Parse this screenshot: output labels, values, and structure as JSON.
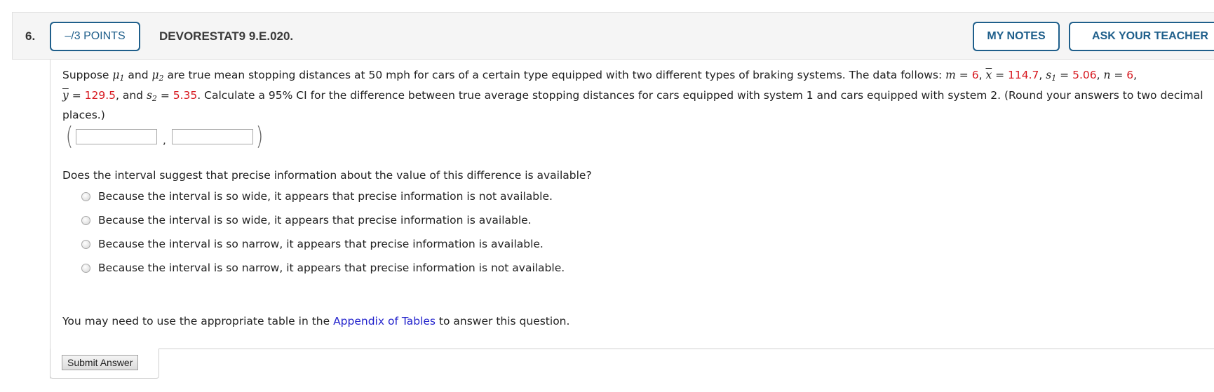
{
  "header": {
    "question_number": "6.",
    "points_label": "–/3 POINTS",
    "question_id": "DEVORESTAT9 9.E.020.",
    "my_notes_label": "MY NOTES",
    "ask_teacher_label": "ASK YOUR TEACHER",
    "accent_color": "#1f5f8b"
  },
  "prompt": {
    "intro_1": "Suppose ",
    "mu": "μ",
    "sub1": "1",
    "and": " and ",
    "sub2": "2",
    "intro_2": " are true mean stopping distances at 50 mph for cars of a certain type equipped with two different types of braking systems. The data follows: ",
    "m_label": "m",
    "eq": " = ",
    "m_value": "6",
    "xbar_label": "x",
    "xbar_value": "114.7",
    "s_label": "s",
    "s1_value": "5.06",
    "n_label": "n",
    "n_value": "6",
    "ybar_label": "y",
    "ybar_value": "129.5",
    "and_s2": ", and ",
    "s2_value": "5.35",
    "intro_3": ". Calculate a 95% CI for the difference between true average stopping distances for cars equipped with system 1 and cars equipped with system 2. (Round your answers to two decimal places.)",
    "given_value_color": "#d71920"
  },
  "interval": {
    "open_paren": "(",
    "close_paren": ")",
    "separator": ",",
    "lower_value": "",
    "upper_value": ""
  },
  "mc": {
    "question": "Does the interval suggest that precise information about the value of this difference is available?",
    "options": [
      {
        "label": "Because the interval is so wide, it appears that precise information is not available.",
        "selected": false
      },
      {
        "label": "Because the interval is so wide, it appears that precise information is available.",
        "selected": false
      },
      {
        "label": "Because the interval is so narrow, it appears that precise information is available.",
        "selected": false
      },
      {
        "label": "Because the interval is so narrow, it appears that precise information is not available.",
        "selected": false
      }
    ]
  },
  "appendix": {
    "before": "You may need to use the appropriate table in the ",
    "link_text": "Appendix of Tables",
    "after": " to answer this question.",
    "link_color": "#2222cc"
  },
  "submit_label": "Submit Answer"
}
